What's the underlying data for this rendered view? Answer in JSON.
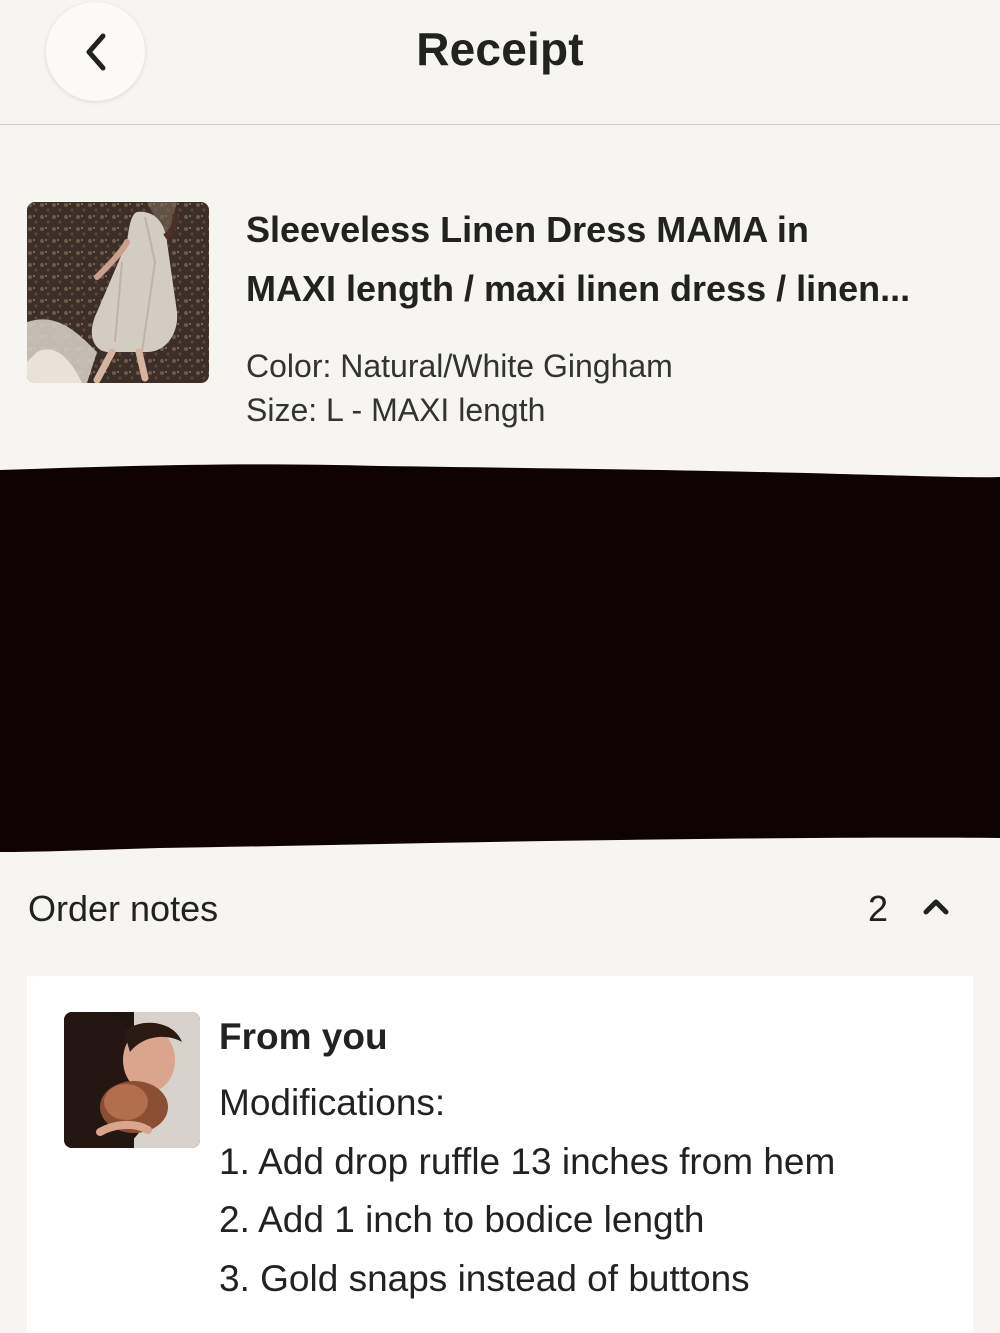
{
  "header": {
    "title": "Receipt",
    "back_icon": "chevron-left-icon"
  },
  "product": {
    "title_line1": "Sleeveless Linen Dress MAMA in",
    "title_line2": "MAXI length / maxi linen dress / linen...",
    "color": "Color: Natural/White Gingham",
    "size": "Size: L - MAXI length"
  },
  "order_notes": {
    "label": "Order notes",
    "count": "2",
    "toggle_icon": "chevron-up-icon",
    "note": {
      "author": "From you",
      "lines": [
        "Modifications:",
        "1. Add drop ruffle 13 inches from hem",
        "2. Add 1 inch to bodice length",
        "3. Gold snaps instead of buttons"
      ]
    }
  },
  "colors": {
    "background": "#f6f5f1",
    "card": "#ffffff",
    "text": "#222222",
    "redaction": "#0e0205"
  }
}
